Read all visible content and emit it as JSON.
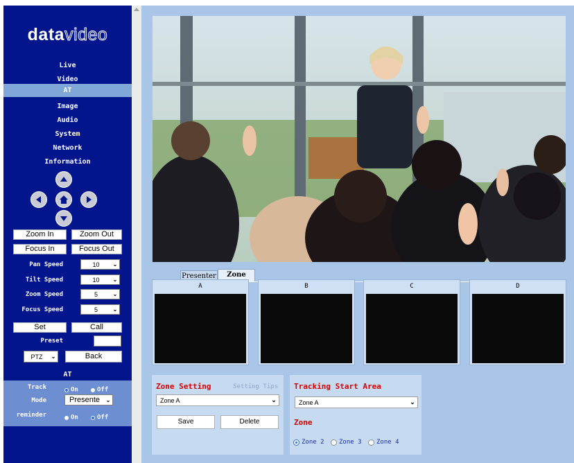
{
  "logo": {
    "part1": "data",
    "part2": "video"
  },
  "nav": [
    {
      "label": "Live"
    },
    {
      "label": "Video"
    },
    {
      "label": "AT",
      "active": true
    },
    {
      "label": "Image"
    },
    {
      "label": "Audio"
    },
    {
      "label": "System"
    },
    {
      "label": "Network"
    },
    {
      "label": "Information"
    }
  ],
  "ptz": {
    "zoom_in": "Zoom In",
    "zoom_out": "Zoom Out",
    "focus_in": "Focus In",
    "focus_out": "Focus Out",
    "pan_speed_label": "Pan Speed",
    "pan_speed_value": "10",
    "tilt_speed_label": "Tilt Speed",
    "tilt_speed_value": "10",
    "zoom_speed_label": "Zoom Speed",
    "zoom_speed_value": "5",
    "focus_speed_label": "Focus Speed",
    "focus_speed_value": "5",
    "set": "Set",
    "call": "Call",
    "preset_label": "Preset",
    "preset_value": "",
    "mode_value": "PTZ",
    "back": "Back"
  },
  "at": {
    "header": "AT",
    "track_label": "Track",
    "on_label": "On",
    "off_label": "Off",
    "mode_label": "Mode",
    "mode_value": "Presente",
    "reminder_label": "reminder",
    "track_selected": "On",
    "reminder_selected": "Off"
  },
  "tabs": {
    "presenter": "Presenter",
    "zone": "Zone",
    "active": "Zone"
  },
  "zones": [
    "A",
    "B",
    "C",
    "D"
  ],
  "zone_setting": {
    "title": "Zone Setting",
    "tips": "Setting Tips",
    "select_value": "Zone A",
    "save": "Save",
    "delete": "Delete"
  },
  "tracking": {
    "title": "Tracking Start Area",
    "select_value": "Zone A",
    "zone_label": "Zone",
    "options": [
      "Zone 2",
      "Zone 3",
      "Zone 4"
    ],
    "selected": "Zone 2"
  },
  "colors": {
    "sidebar": "#02158c",
    "nav_active": "#7fa8d8",
    "main_bg": "#a9c6e8",
    "title_red": "#d60000"
  }
}
